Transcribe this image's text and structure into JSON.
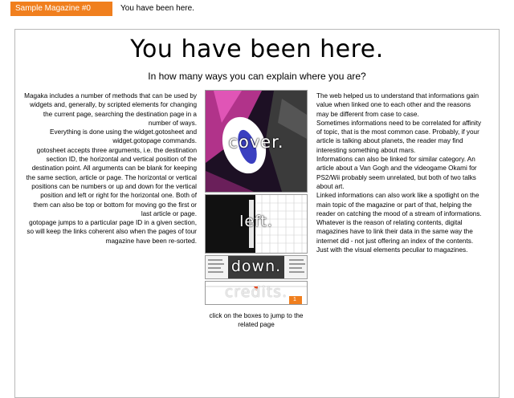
{
  "header": {
    "magazine_tab": "Sample Magazine #0",
    "location_label": "You have been here."
  },
  "page": {
    "title": "You have been here.",
    "subtitle": "In how many ways you can explain where you are?"
  },
  "left_column": [
    "Magaka includes a number of methods that can be used by widgets and, generally, by scripted elements for changing the current page, searching the destination page in a number of ways.",
    "Everything is done using the widget.gotosheet and widget.gotopage commands.",
    "gotosheet accepts three arguments, i.e. the destination section ID, the horizontal and vertical position of the destination point. All arguments can be blank for keeping the same section, article or page. The horizontal or vertical positions can be numbers or up and down for the vertical position and left or right for the horizontal one. Both of them can also be top or bottom for moving go the first or last article or page.",
    "gotopage jumps to a particular page ID in a given section, so will keep the links coherent also when the pages of tour magazine have been re-sorted."
  ],
  "right_column": [
    "The web helped us to understand that informations gain value when linked one to each other and the reasons may be different from case to case.",
    "Sometimes informations need to be correlated for affinity of topic, that is the most common case. Probably, if your article is talking about planets, the reader may find interesting something about mars.",
    "Informations can also be linked for similar category. An article about a Van Gogh and the videogame Okami for PS2/Wii probably seem unrelated, but both of two talks about art.",
    "Linked informations can also work like a spotlight on the main topic of the magazine or part of that, helping the reader on catching the mood of a stream of informations.",
    "Whatever is the reason of relating contents, digital magazines have to link their data in the same way the internet did - not just offering an index of the contents. Just with the visual elements peculiar to magazines."
  ],
  "nav_boxes": {
    "cover": "cover.",
    "left": "left.",
    "down": "down.",
    "credits": "credits.",
    "credits_badge": "1"
  },
  "caption": "click on the boxes to jump to the related page",
  "colors": {
    "accent": "#f07f1e",
    "frame_border": "#b9b9b9"
  }
}
